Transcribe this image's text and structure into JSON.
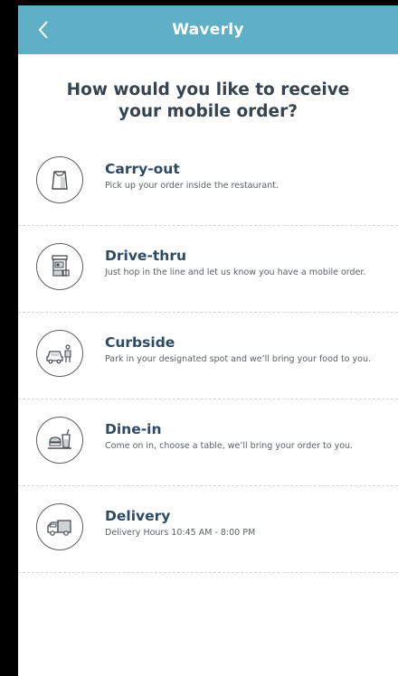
{
  "header": {
    "title": "Waverly",
    "back_icon": "chevron-left-icon"
  },
  "question": "How would you like to receive your mobile order?",
  "options": [
    {
      "title": "Carry-out",
      "description": "Pick up your order inside the restaurant.",
      "icon": "shopping-bag-icon"
    },
    {
      "title": "Drive-thru",
      "description": "Just hop in the line and let us know you have a mobile order.",
      "icon": "drive-thru-window-icon"
    },
    {
      "title": "Curbside",
      "description": "Park in your designated spot and we’ll bring your food to you.",
      "icon": "car-with-person-icon"
    },
    {
      "title": "Dine-in",
      "description": "Come on in, choose a table, we’ll bring your order to you.",
      "icon": "tray-with-drink-icon"
    },
    {
      "title": "Delivery",
      "description": "Delivery Hours 10:45 AM - 8:00 PM",
      "icon": "delivery-van-icon"
    }
  ],
  "colors": {
    "header": "#5fb0c6",
    "title_text": "#2c4a63",
    "body_text": "#5b6267"
  }
}
